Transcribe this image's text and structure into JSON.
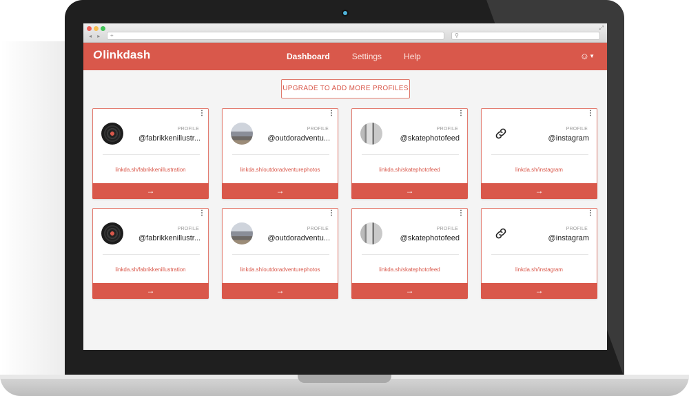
{
  "app": {
    "logo": "linkdash",
    "logo_mark": "O"
  },
  "browser": {
    "nav_arrows": "◂ ▸",
    "url_placeholder": "+",
    "search_icon": "search-icon",
    "expand_icon": "expand-icon"
  },
  "header": {
    "nav": [
      "Dashboard",
      "Settings",
      "Help"
    ],
    "active": "Dashboard",
    "user_icon": "user-icon"
  },
  "upgrade_label": "UPGRADE TO ADD MORE PROFILES",
  "colors": {
    "accent": "#d9584b",
    "background": "#f4f4f4"
  },
  "cards": [
    {
      "type": "PROFILE",
      "handle": "@fabrikkenillustr...",
      "link": "linkda.sh/fabrikkenillustration",
      "avatar": "vinyl-record-image"
    },
    {
      "type": "PROFILE",
      "handle": "@outdoradventu...",
      "link": "linkda.sh/outdoradventurephotos",
      "avatar": "mountain-landscape-image"
    },
    {
      "type": "PROFILE",
      "handle": "@skatephotofeed",
      "link": "linkda.sh/skatephotofeed",
      "avatar": "skatepark-image"
    },
    {
      "type": "PROFILE",
      "handle": "@instagram",
      "link": "linkda.sh/instagram",
      "avatar": "link-icon"
    },
    {
      "type": "PROFILE",
      "handle": "@fabrikkenillustr...",
      "link": "linkda.sh/fabrikkenillustration",
      "avatar": "vinyl-record-image"
    },
    {
      "type": "PROFILE",
      "handle": "@outdoradventu...",
      "link": "linkda.sh/outdoradventurephotos",
      "avatar": "mountain-landscape-image"
    },
    {
      "type": "PROFILE",
      "handle": "@skatephotofeed",
      "link": "linkda.sh/skatephotofeed",
      "avatar": "skatepark-image"
    },
    {
      "type": "PROFILE",
      "handle": "@instagram",
      "link": "linkda.sh/instagram",
      "avatar": "link-icon"
    }
  ],
  "card_menu_icon": "kebab-menu-icon",
  "card_go_icon": "arrow-right-icon",
  "card_go_glyph": "→",
  "card_menu_glyph": "⋮"
}
